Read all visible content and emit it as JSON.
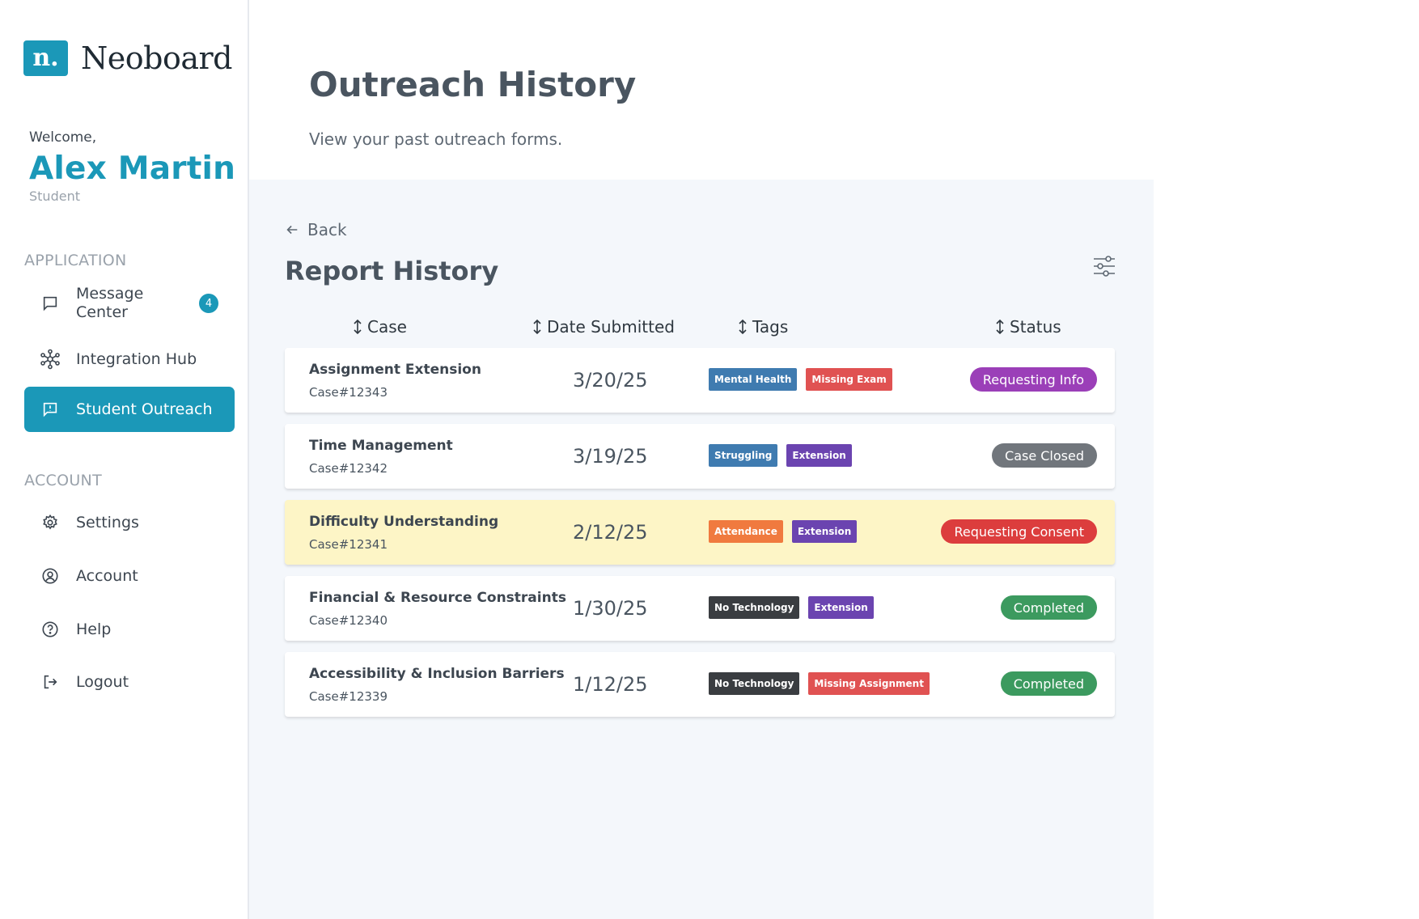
{
  "brand": {
    "logo_mark": "n.",
    "name": "Neoboard",
    "accent": "#1b98b8"
  },
  "user": {
    "welcome": "Welcome,",
    "name": "Alex Martin",
    "role": "Student"
  },
  "sidebar": {
    "application_label": "APPLICATION",
    "account_label": "ACCOUNT",
    "items": [
      {
        "label": "Message\nCenter",
        "icon": "chat-icon",
        "badge": "4"
      },
      {
        "label": "Integration Hub",
        "icon": "network-icon"
      },
      {
        "label": "Student Outreach",
        "icon": "report-icon",
        "active": true
      },
      {
        "label": "Settings",
        "icon": "gear-icon"
      },
      {
        "label": "Account",
        "icon": "user-circle-icon"
      },
      {
        "label": "Help",
        "icon": "help-icon"
      },
      {
        "label": "Logout",
        "icon": "logout-icon"
      }
    ]
  },
  "header": {
    "title": "Outreach History",
    "subtitle": "View your past outreach forms."
  },
  "panel": {
    "back_label": "Back",
    "title": "Report History",
    "columns": [
      "Case",
      "Date Submitted",
      "Tags",
      "Status"
    ]
  },
  "rows": [
    {
      "title": "Assignment Extension",
      "case_id": "Case#12343",
      "date": "3/20/25",
      "tags": [
        {
          "label": "Mental Health",
          "color": "#3f7bb0"
        },
        {
          "label": "Missing Exam",
          "color": "#e05252"
        }
      ],
      "status": {
        "label": "Requesting Info",
        "color": "#9b3fb8"
      }
    },
    {
      "title": "Time Management",
      "case_id": "Case#12342",
      "date": "3/19/25",
      "tags": [
        {
          "label": "Struggling",
          "color": "#3f7bb0"
        },
        {
          "label": "Extension",
          "color": "#6b44b0"
        }
      ],
      "status": {
        "label": "Case Closed",
        "color": "#71767c"
      }
    },
    {
      "title": "Difficulty Understanding",
      "case_id": "Case#12341",
      "date": "2/12/25",
      "highlighted": true,
      "tags": [
        {
          "label": "Attendance",
          "color": "#f07a3f"
        },
        {
          "label": "Extension",
          "color": "#6b44b0"
        }
      ],
      "status": {
        "label": "Requesting Consent",
        "color": "#dc3d3d"
      }
    },
    {
      "title": "Financial & Resource Constraints",
      "case_id": "Case#12340",
      "date": "1/30/25",
      "tags": [
        {
          "label": "No Technology",
          "color": "#3a3d41"
        },
        {
          "label": "Extension",
          "color": "#6b44b0"
        }
      ],
      "status": {
        "label": "Completed",
        "color": "#3c9a5f"
      }
    },
    {
      "title": "Accessibility & Inclusion Barriers",
      "case_id": "Case#12339",
      "date": "1/12/25",
      "tags": [
        {
          "label": "No Technology",
          "color": "#3a3d41"
        },
        {
          "label": "Missing Assignment",
          "color": "#e05252"
        }
      ],
      "status": {
        "label": "Completed",
        "color": "#3c9a5f"
      }
    }
  ]
}
